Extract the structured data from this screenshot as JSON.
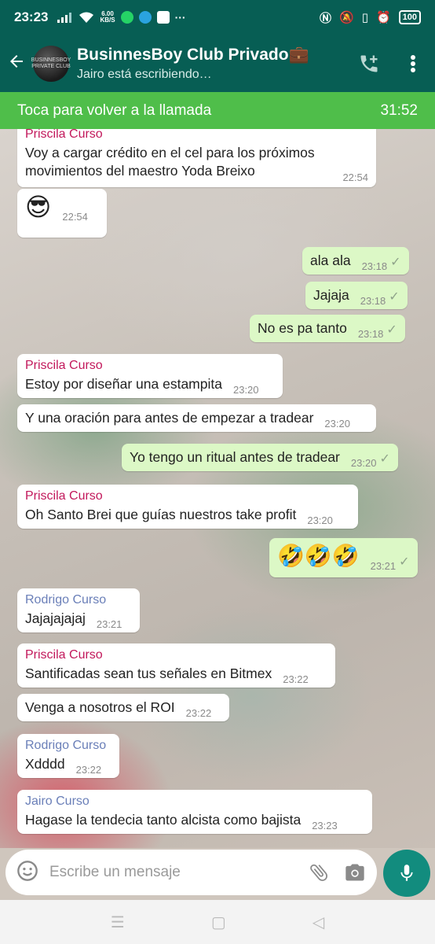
{
  "status_bar": {
    "time": "23:23",
    "net_speed_value": "6.00",
    "net_speed_unit": "KB/S",
    "battery": "100"
  },
  "header": {
    "avatar_text": "BUSINNESBOY PRIVATE CLUB",
    "title": "BusinnesBoy Club Privado💼",
    "subtitle": "Jairo está escribiendo…"
  },
  "call_banner": {
    "label": "Toca para volver a la llamada",
    "timer": "31:52"
  },
  "messages": [
    {
      "sender": "Priscila Curso",
      "text": "Voy a cargar crédito en el cel para los próximos movimientos del maestro Yoda Breixo",
      "time": "22:54"
    },
    {
      "text": "😎",
      "time": "22:54"
    },
    {
      "text": "ala ala",
      "time": "23:18",
      "tick": "✓"
    },
    {
      "text": "Jajaja",
      "time": "23:18",
      "tick": "✓"
    },
    {
      "text": "No es pa tanto",
      "time": "23:18",
      "tick": "✓"
    },
    {
      "sender": "Priscila Curso",
      "text": "Estoy por diseñar una estampita",
      "time": "23:20"
    },
    {
      "text": "Y una oración para antes de empezar a tradear",
      "time": "23:20"
    },
    {
      "text": "Yo tengo un ritual antes de tradear",
      "time": "23:20",
      "tick": "✓"
    },
    {
      "sender": "Priscila Curso",
      "text": "Oh Santo Brei que guías nuestros take profit",
      "time": "23:20"
    },
    {
      "text": "🤣🤣🤣",
      "time": "23:21",
      "tick": "✓"
    },
    {
      "sender": "Rodrigo Curso",
      "text": "Jajajajajaj",
      "time": "23:21"
    },
    {
      "sender": "Priscila Curso",
      "text": "Santificadas sean tus señales en Bitmex",
      "time": "23:22"
    },
    {
      "text": "Venga a nosotros el ROI",
      "time": "23:22"
    },
    {
      "sender": "Rodrigo Curso",
      "text": "Xdddd",
      "time": "23:22"
    },
    {
      "sender": "Jairo Curso",
      "text": "Hagase la tendecia tanto alcista como bajista",
      "time": "23:23"
    }
  ],
  "input": {
    "placeholder": "Escribe un mensaje"
  },
  "icons": {
    "back": "back-arrow-icon",
    "add_call": "add-call-icon",
    "menu": "more-vert-icon",
    "emoji": "emoji-icon",
    "attach": "attach-icon",
    "camera": "camera-icon",
    "mic": "mic-icon"
  },
  "colors": {
    "header": "#075e54",
    "call_banner": "#4fbe4a",
    "outgoing_bubble": "#dcf8c6",
    "mic_button": "#128c7e"
  }
}
